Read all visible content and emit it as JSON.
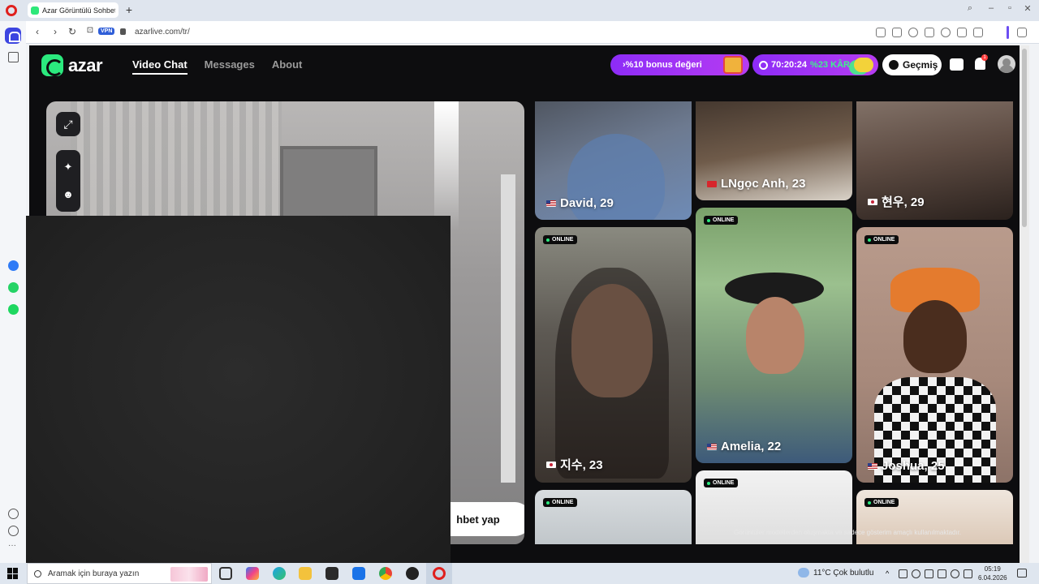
{
  "browser": {
    "tab_title": "Azar Görüntülü Sohbet &",
    "new_tab_icon": "plus-icon",
    "vpn_label": "VPN",
    "url": "azarlive.com/tr/"
  },
  "header": {
    "logo_text": "azar",
    "nav": [
      {
        "label": "Video Chat",
        "active": true
      },
      {
        "label": "Messages",
        "active": false
      },
      {
        "label": "About",
        "active": false
      }
    ],
    "bonus_text": "›%10 bonus değeri",
    "timer": "70:20:24",
    "timer_offer": "%23 KÂR",
    "history_label": "Geçmiş",
    "notification_count": "1"
  },
  "camera": {
    "start_button_label": "hbet yap"
  },
  "cards": [
    {
      "name": "David, 29",
      "flag": "us",
      "online": false
    },
    {
      "name": "LNgọc Anh, 23",
      "flag": "vn",
      "online": false
    },
    {
      "name": "현우, 29",
      "flag": "kr",
      "online": false
    },
    {
      "name": "지수, 23",
      "flag": "kr",
      "online": true
    },
    {
      "name": "Amelia, 22",
      "flag": "us",
      "online": true
    },
    {
      "name": "Joshua, 25",
      "flag": "us",
      "online": true
    },
    {
      "name": "",
      "flag": "",
      "online": true
    },
    {
      "name": "",
      "flag": "",
      "online": true
    },
    {
      "name": "",
      "flag": "",
      "online": true
    }
  ],
  "online_label": "ONLINE",
  "disclaimer": "Görüntüler modellerden oluşmakta ve sadece gösterim amaçlı kullanılmaktadır.",
  "taskbar": {
    "search_placeholder": "Aramak için buraya yazın",
    "weather": "11°C  Çok bulutlu",
    "time": "05:19",
    "date": "6.04.2026"
  },
  "colors": {
    "brand_green": "#2bea7e",
    "promo_purple": "#8d2cf7",
    "page_bg": "#0d0d0f"
  }
}
